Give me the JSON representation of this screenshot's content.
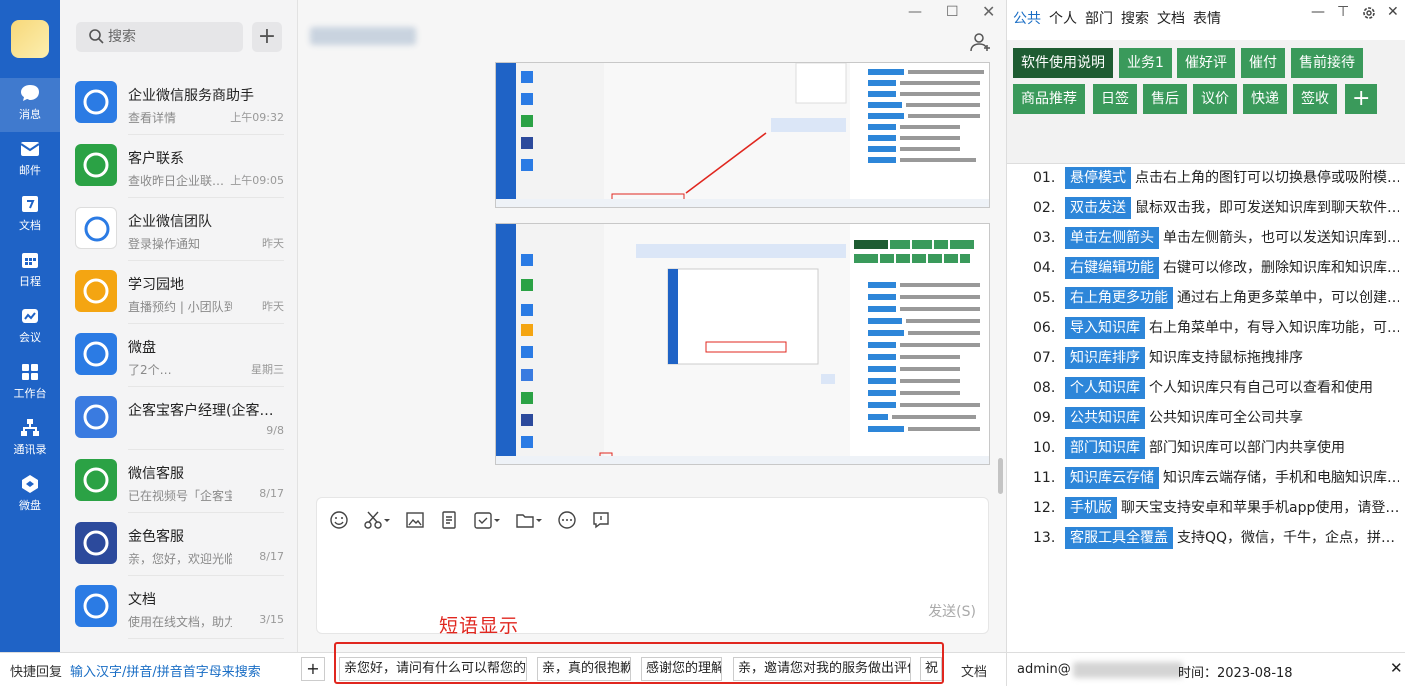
{
  "nav": {
    "items": [
      {
        "label": "消息",
        "icon": "chat-bubble-icon"
      },
      {
        "label": "邮件",
        "icon": "mail-icon"
      },
      {
        "label": "文档",
        "icon": "document-icon"
      },
      {
        "label": "日程",
        "icon": "calendar-icon"
      },
      {
        "label": "会议",
        "icon": "meeting-icon"
      },
      {
        "label": "工作台",
        "icon": "grid-icon"
      },
      {
        "label": "通讯录",
        "icon": "contacts-icon"
      },
      {
        "label": "微盘",
        "icon": "drive-icon"
      }
    ]
  },
  "list": {
    "search_placeholder": "搜索",
    "add_label": "+",
    "conversations": [
      {
        "title": "企业微信服务商助手",
        "preview": "查看详情",
        "time": "上午09:32",
        "color": "#2b7be4"
      },
      {
        "title": "客户联系",
        "preview": "查收昨日企业联…",
        "time": "上午09:05",
        "color": "#2ba245"
      },
      {
        "title": "企业微信团队",
        "preview": "登录操作通知",
        "time": "昨天",
        "color": "#ffffff"
      },
      {
        "title": "学习园地",
        "preview": "直播预约 | 小团队到…",
        "time": "昨天",
        "color": "#f4a512"
      },
      {
        "title": "微盘",
        "preview": "了2个…",
        "time": "星期三",
        "color": "#2b7be4"
      },
      {
        "title": "企客宝客户经理(企客…",
        "preview": "",
        "time": "9/8",
        "color": "#3a7be0"
      },
      {
        "title": "微信客服",
        "preview": "已在视频号「企客宝…",
        "time": "8/17",
        "color": "#2ba245"
      },
      {
        "title": "金色客服",
        "preview": "亲，您好，欢迎光临…",
        "time": "8/17",
        "color": "#2c4a9c"
      },
      {
        "title": "文档",
        "preview": "使用在线文档，助力…",
        "time": "3/15",
        "color": "#2b7be4"
      }
    ]
  },
  "chat": {
    "send_label": "发送(S)",
    "annotation": "短语显示"
  },
  "quick_reply": {
    "label": "快捷回复",
    "hint": "输入汉字/拼音/拼音首字母来搜索",
    "plus": "+",
    "phrases": [
      "亲您好，请问有什么可以帮您的?",
      "亲，真的很抱歉",
      "感谢您的理解",
      "亲，邀请您对我的服务做出评价",
      "祝"
    ],
    "doc_label": "文档"
  },
  "right": {
    "tabs": [
      "公共",
      "个人",
      "部门",
      "搜索",
      "文档",
      "表情"
    ],
    "active_tab": "公共",
    "tags_row1": [
      "软件使用说明",
      "业务1",
      "催好评",
      "催付",
      "售前接待"
    ],
    "tags_row2": [
      "商品推荐",
      "日签",
      "售后",
      "议价",
      "快递",
      "签收"
    ],
    "tag_add": "+",
    "knowledge": [
      {
        "num": "01.",
        "key": "悬停模式",
        "desc": "点击右上角的图钉可以切换悬停或吸附模…"
      },
      {
        "num": "02.",
        "key": "双击发送",
        "desc": "鼠标双击我，即可发送知识库到聊天软件…"
      },
      {
        "num": "03.",
        "key": "单击左侧箭头",
        "desc": "单击左侧箭头，也可以发送知识库到…"
      },
      {
        "num": "04.",
        "key": "右键编辑功能",
        "desc": "右键可以修改，删除知识库和知识库…"
      },
      {
        "num": "05.",
        "key": "右上角更多功能",
        "desc": "通过右上角更多菜单中，可以创建…"
      },
      {
        "num": "06.",
        "key": "导入知识库",
        "desc": "右上角菜单中，有导入知识库功能，可…"
      },
      {
        "num": "07.",
        "key": "知识库排序",
        "desc": "知识库支持鼠标拖拽排序"
      },
      {
        "num": "08.",
        "key": "个人知识库",
        "desc": "个人知识库只有自己可以查看和使用"
      },
      {
        "num": "09.",
        "key": "公共知识库",
        "desc": "公共知识库可全公司共享"
      },
      {
        "num": "10.",
        "key": "部门知识库",
        "desc": "部门知识库可以部门内共享使用"
      },
      {
        "num": "11.",
        "key": "知识库云存储",
        "desc": "知识库云端存储，手机和电脑知识库…"
      },
      {
        "num": "12.",
        "key": "手机版",
        "desc": "聊天宝支持安卓和苹果手机app使用，请登…"
      },
      {
        "num": "13.",
        "key": "客服工具全覆盖",
        "desc": "支持QQ，微信，千牛，企点，拼…"
      }
    ],
    "footer_user": "admin@",
    "footer_time": "时间：2023-08-18"
  }
}
